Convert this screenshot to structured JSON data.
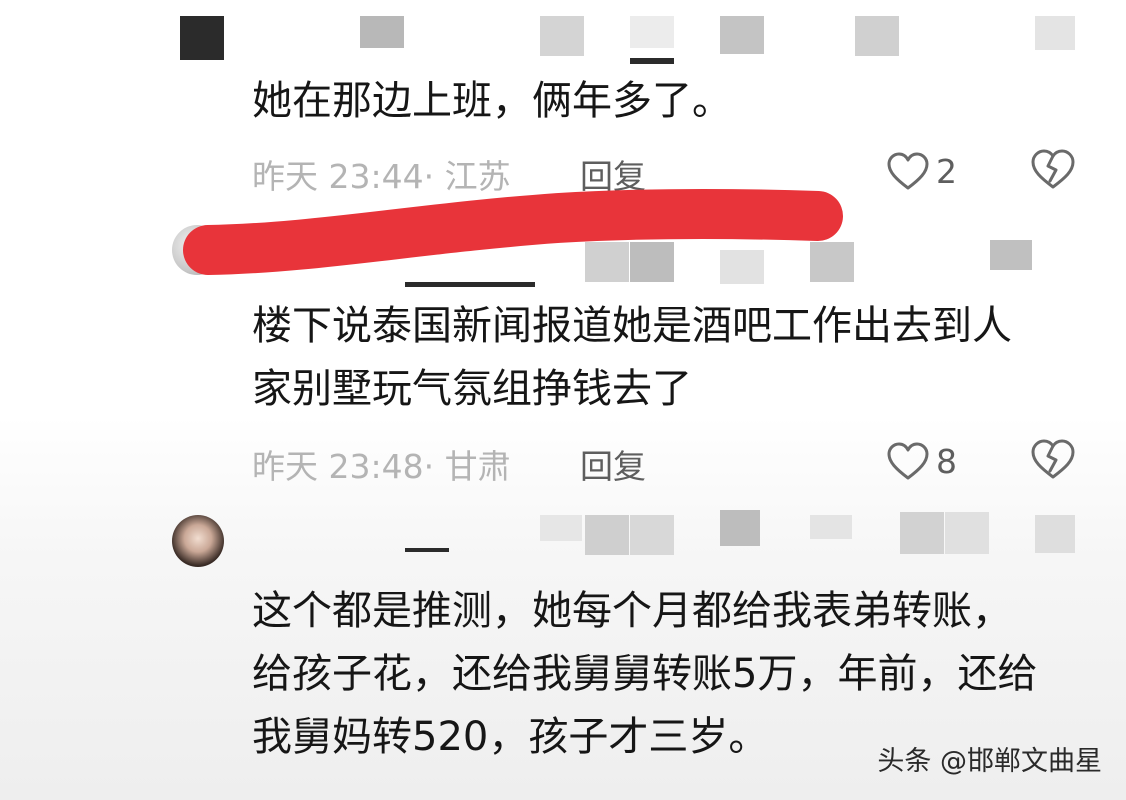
{
  "comments": [
    {
      "text_lines": [
        "她在那边上班，俩年多了。"
      ],
      "time_location": "昨天 23:44· 江苏",
      "reply_label": "回复",
      "like_count": "2"
    },
    {
      "text_lines": [
        "楼下说泰国新闻报道她是酒吧工作出去到人",
        "家别墅玩气氛组挣钱去了"
      ],
      "time_location": "昨天 23:48· 甘肃",
      "reply_label": "回复",
      "like_count": "8"
    },
    {
      "text_lines": [
        "这个都是推测，她每个月都给我表弟转账，",
        "给孩子花，还给我舅舅转账5万，年前，还给",
        "我舅妈转520，孩子才三岁。"
      ]
    }
  ],
  "icons": {
    "like": "heart-outline-icon",
    "dislike": "broken-heart-icon"
  },
  "colors": {
    "redaction": "#e8343a",
    "meta_text": "#b4b4b4",
    "reply_text": "#5e5e5e",
    "body_text": "#161616"
  },
  "watermark": "头条 @邯郸文曲星"
}
